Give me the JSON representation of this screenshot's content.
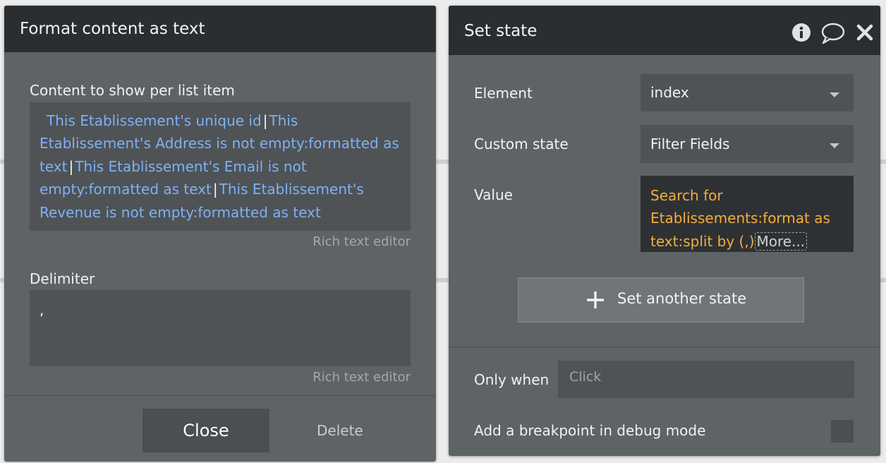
{
  "left_panel": {
    "title": "Format content as text",
    "content_label": "Content to show per list item",
    "content_expression": [
      "This Etablissement's unique id",
      "This Etablissement's Address is not empty:formatted as text",
      "This Etablissement's Email is not empty:formatted as text",
      "This Etablissement's Revenue is not empty:formatted as text"
    ],
    "separator": "|",
    "rich_text_hint_1": "Rich text editor",
    "delimiter_label": "Delimiter",
    "delimiter_value": ",",
    "rich_text_hint_2": "Rich text editor",
    "close_label": "Close",
    "delete_label": "Delete"
  },
  "right_panel": {
    "title": "Set state",
    "icons": [
      "info-icon",
      "comment-icon",
      "close-icon"
    ],
    "element_label": "Element",
    "element_value": "index",
    "custom_state_label": "Custom state",
    "custom_state_value": "Filter Fields",
    "value_label": "Value",
    "value_expression": "Search for Etablissements:format as text:split by (,)",
    "value_more": "More...",
    "add_state_label": "Set another state",
    "only_when_label": "Only when",
    "only_when_placeholder": "Click",
    "breakpoint_label": "Add a breakpoint in debug mode"
  },
  "colors": {
    "header": "#2b2e31",
    "panel": "#5e6366",
    "dynamic_expression": "#7fb1f4",
    "value_expression": "#f4ad3b"
  }
}
